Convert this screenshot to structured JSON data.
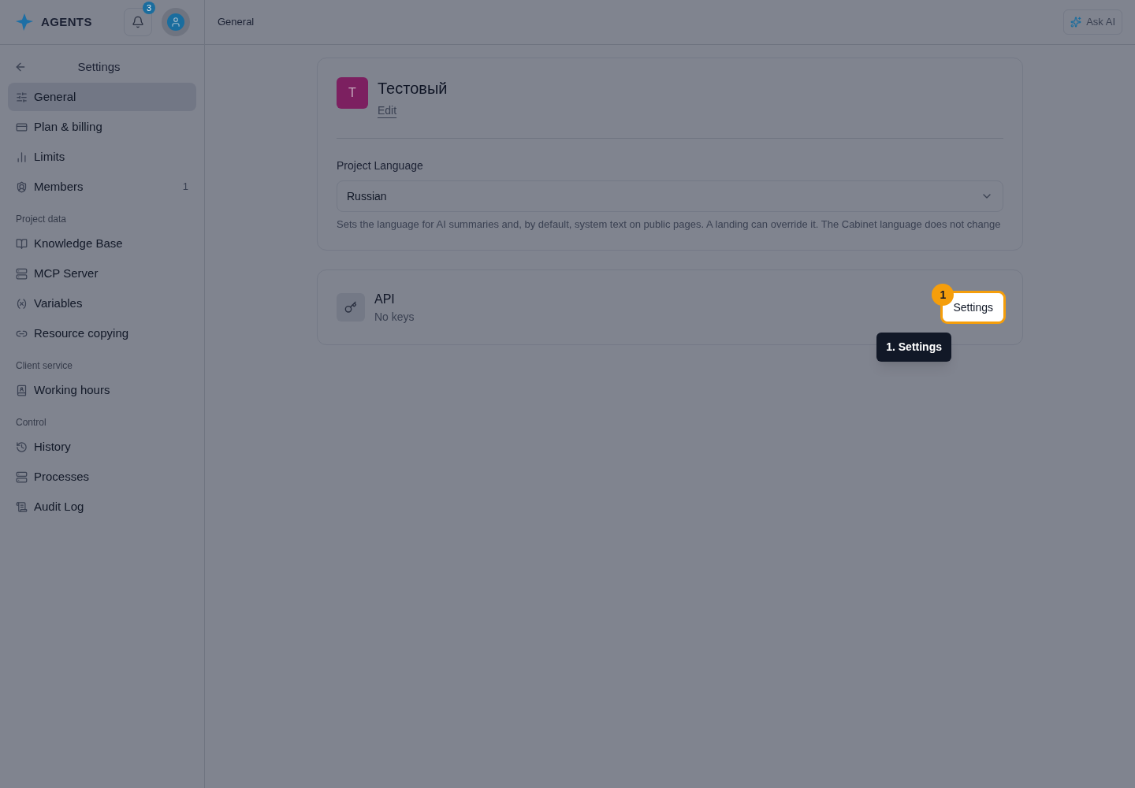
{
  "header": {
    "logo": "AGENTS",
    "notification_count": "3",
    "breadcrumb": "General",
    "ask_ai": "Ask AI"
  },
  "sidebar": {
    "title": "Settings",
    "sections": [
      {
        "items": [
          {
            "label": "General",
            "selected": true
          },
          {
            "label": "Plan & billing",
            "selected": false
          },
          {
            "label": "Limits",
            "selected": false
          },
          {
            "label": "Members",
            "selected": false,
            "count": "1"
          }
        ]
      },
      {
        "heading": "Project data",
        "items": [
          {
            "label": "Knowledge Base",
            "selected": false
          },
          {
            "label": "MCP Server",
            "selected": false
          },
          {
            "label": "Variables",
            "selected": false
          },
          {
            "label": "Resource copying",
            "selected": false
          }
        ]
      },
      {
        "heading": "Client service",
        "items": [
          {
            "label": "Working hours",
            "selected": false
          }
        ]
      },
      {
        "heading": "Control",
        "items": [
          {
            "label": "History",
            "selected": false
          },
          {
            "label": "Processes",
            "selected": false
          },
          {
            "label": "Audit Log",
            "selected": false
          }
        ]
      }
    ]
  },
  "project": {
    "avatar_letter": "T",
    "name": "Тестовый",
    "edit_link": "Edit",
    "language_label": "Project Language",
    "language_value": "Russian",
    "language_hint": "Sets the language for AI summaries and, by default, system text on public pages. A landing can override it. The Cabinet language does not change"
  },
  "api": {
    "title": "API",
    "subtitle": "No keys",
    "button": {
      "label": "Settings",
      "highlighted": true
    }
  },
  "tour": {
    "step_badge": "1",
    "tooltip": "1. Settings"
  }
}
